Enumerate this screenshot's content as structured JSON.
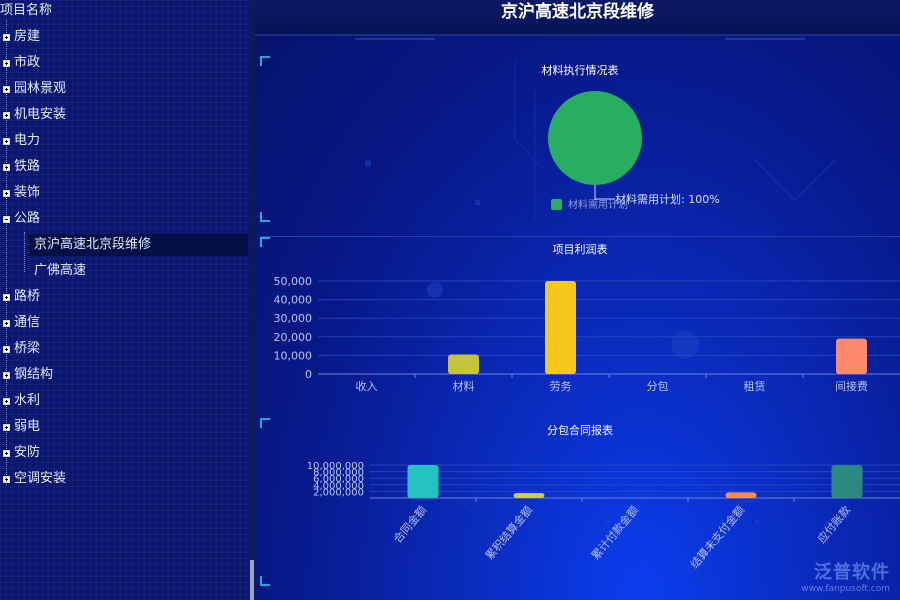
{
  "tree": {
    "header": "项目名称",
    "items": [
      {
        "label": "房建",
        "expanded": false
      },
      {
        "label": "市政",
        "expanded": false
      },
      {
        "label": "园林景观",
        "expanded": false
      },
      {
        "label": "机电安装",
        "expanded": false
      },
      {
        "label": "电力",
        "expanded": false
      },
      {
        "label": "铁路",
        "expanded": false
      },
      {
        "label": "装饰",
        "expanded": false
      },
      {
        "label": "公路",
        "expanded": true
      },
      {
        "label": "路桥",
        "expanded": false
      },
      {
        "label": "通信",
        "expanded": false
      },
      {
        "label": "桥梁",
        "expanded": false
      },
      {
        "label": "钢结构",
        "expanded": false
      },
      {
        "label": "水利",
        "expanded": false
      },
      {
        "label": "弱电",
        "expanded": false
      },
      {
        "label": "安防",
        "expanded": false
      },
      {
        "label": "空调安装",
        "expanded": false
      }
    ],
    "children": [
      {
        "label": "京沪高速北京段维修",
        "selected": true
      },
      {
        "label": "广佛高速",
        "selected": false
      }
    ]
  },
  "dashboard": {
    "title": "京沪高速北京段维修"
  },
  "chart_data": [
    {
      "type": "pie",
      "title": "材料执行情况表",
      "slices": [
        {
          "label": "材料需用计划",
          "value": 100,
          "percent_label": "材料需用计划: 100%"
        }
      ],
      "legend": [
        "材料需用计划"
      ],
      "legend_position": "bottom",
      "colors": [
        "#27ae60"
      ]
    },
    {
      "type": "bar",
      "title": "项目利润表",
      "categories": [
        "收入",
        "材料",
        "劳务",
        "分包",
        "租赁",
        "间接费"
      ],
      "values": [
        0,
        10500,
        50000,
        0,
        0,
        19000
      ],
      "yticks": [
        "0",
        "10,000",
        "20,000",
        "30,000",
        "40,000",
        "50,000"
      ],
      "ylim": [
        0,
        50000
      ],
      "colors": [
        "#c9d142",
        "#c4c43a",
        "#f7c81a",
        "#888888",
        "#888888",
        "#ff8a6b"
      ],
      "grid": true
    },
    {
      "type": "bar",
      "title": "分包合同报表",
      "categories": [
        "合同金额",
        "累积结算金额",
        "累计付款金额",
        "结算未支付金额",
        "应付账款"
      ],
      "values": [
        10000000,
        1500000,
        0,
        1700000,
        10000000
      ],
      "yticks": [
        "2,000,000",
        "4,000,000",
        "6,000,000",
        "8,000,000",
        "10,000,000"
      ],
      "ylim": [
        0,
        10000000
      ],
      "colors": [
        "#25c2c2",
        "#c9d142",
        "#888888",
        "#ff8a4a",
        "#2a8a80"
      ],
      "grid": true
    }
  ],
  "watermark": {
    "name": "泛普软件",
    "url": "www.fanpusoft.com"
  }
}
